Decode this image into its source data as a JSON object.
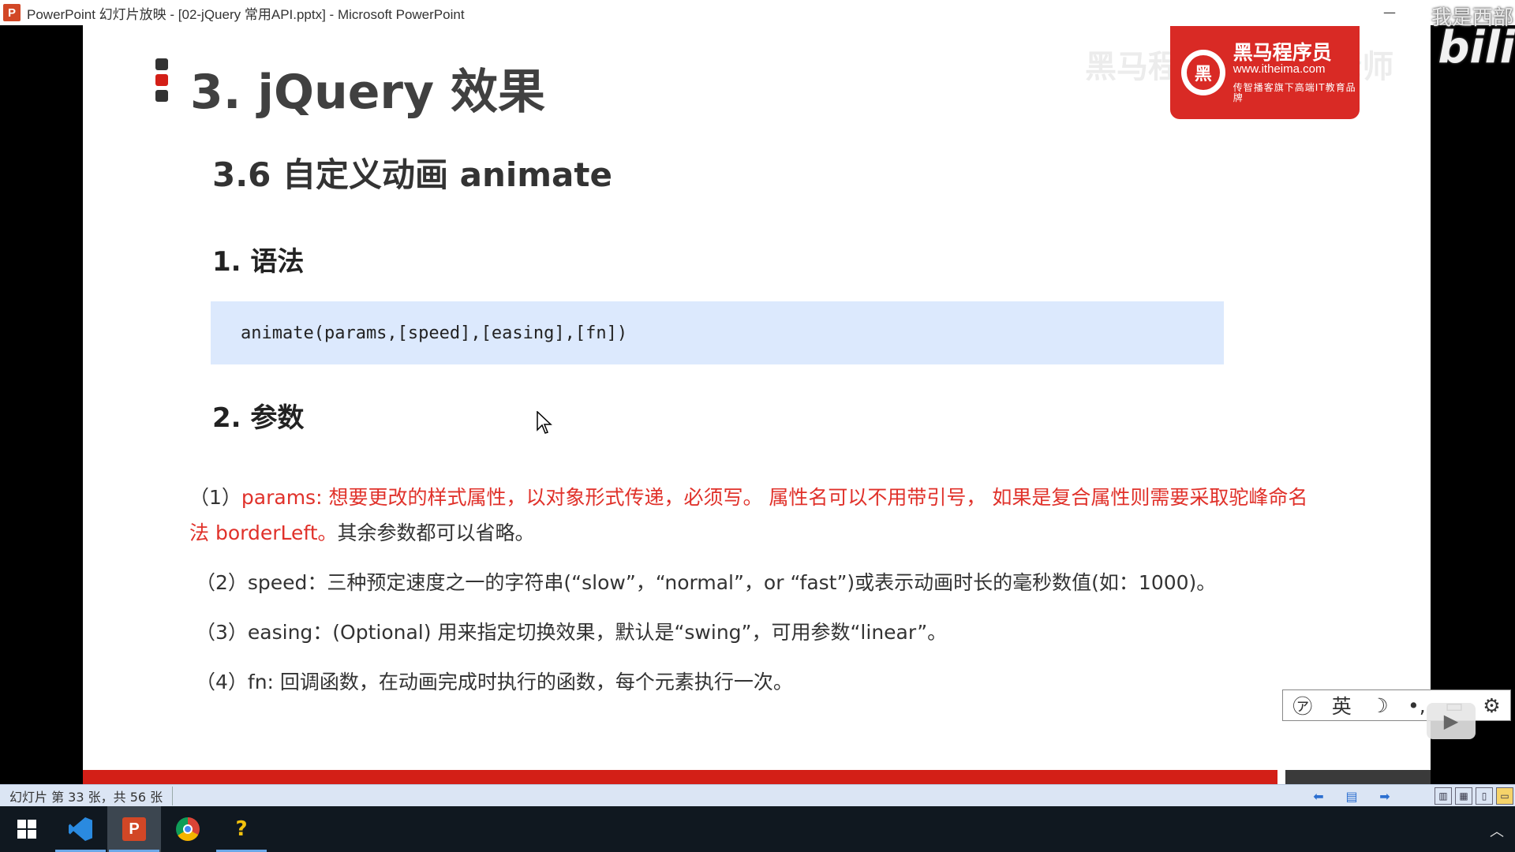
{
  "window": {
    "app_icon_letter": "P",
    "title": "PowerPoint 幻灯片放映 - [02-jQuery 常用API.pptx] - Microsoft PowerPoint",
    "minimize_glyph": "—",
    "watermark_top_right": "我是西部",
    "bili_logo": "bili"
  },
  "slide": {
    "title": "3. jQuery 效果",
    "subtitle": "3.6  自定义动画 animate",
    "section1": "1. 语法",
    "code": "animate(params,[speed],[easing],[fn])",
    "section2": "2. 参数",
    "params": [
      {
        "prefix": "（1）",
        "red_text": "params: 想要更改的样式属性，以对象形式传递，必须写。 属性名可以不用带引号， 如果是复合属性则需要采取驼峰命名法 borderLeft。",
        "rest": "其余参数都可以省略。"
      },
      {
        "prefix": "（2）",
        "text": "speed：三种预定速度之一的字符串(“slow”，“normal”，or “fast”)或表示动画时长的毫秒数值(如：1000)。"
      },
      {
        "prefix": "（3）",
        "text": "easing：(Optional) 用来指定切换效果，默认是“swing”，可用参数“linear”。"
      },
      {
        "prefix": "（4）",
        "text": "fn: 回调函数，在动画完成时执行的函数，每个元素执行一次。"
      }
    ],
    "logo": {
      "circle_glyph": "黑",
      "name": "黑马程序员",
      "url": "www.itheima.com",
      "slogan": "传智播客旗下高端IT教育品牌"
    },
    "overlay_watermark": "黑马程序员 pink老师"
  },
  "widget": {
    "items": [
      "㋐",
      "英",
      "☽",
      "•,",
      "▭",
      "⚙"
    ]
  },
  "statusbar": {
    "slide_info": "幻灯片 第 33 张，共 56 张"
  },
  "colors": {
    "accent_red": "#d31f17",
    "code_bg": "#dce9fd",
    "text_red": "#e0312a"
  }
}
